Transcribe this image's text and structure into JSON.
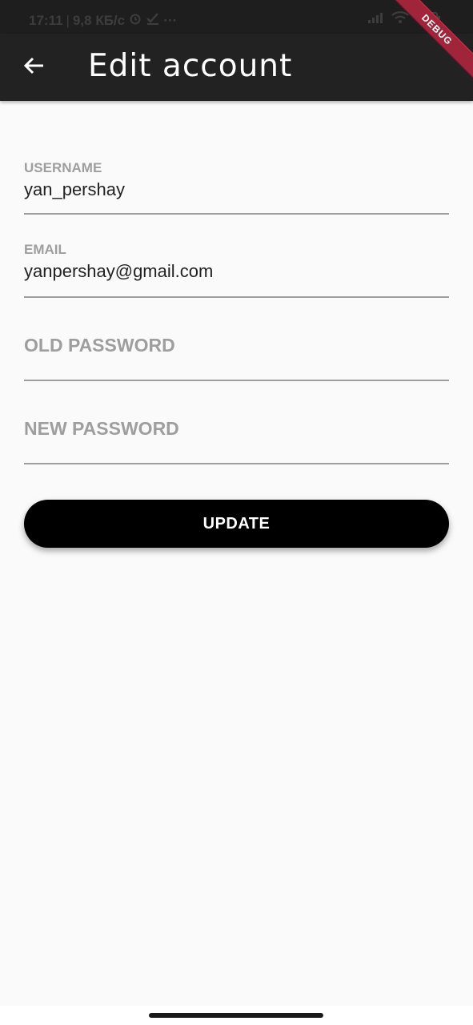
{
  "status_bar": {
    "time": "17:11",
    "network_speed": "9,8 КБ/с",
    "more": "···"
  },
  "app_bar": {
    "title": "Edit account",
    "debug_label": "DEBUG"
  },
  "form": {
    "username": {
      "label": "USERNAME",
      "value": "yan_pershay"
    },
    "email": {
      "label": "EMAIL",
      "value": "yanpershay@gmail.com"
    },
    "old_password": {
      "placeholder": "OLD PASSWORD",
      "value": ""
    },
    "new_password": {
      "placeholder": "NEW PASSWORD",
      "value": ""
    }
  },
  "actions": {
    "update_label": "UPDATE"
  },
  "colors": {
    "app_bar": "#222222",
    "background": "#fafafa",
    "button": "#000000",
    "label": "#9e9e9e",
    "debug_banner": "#a0243a"
  },
  "icons": [
    "back-arrow-icon",
    "alarm-icon",
    "check-icon",
    "signal-icon",
    "wifi-icon",
    "battery-icon"
  ]
}
